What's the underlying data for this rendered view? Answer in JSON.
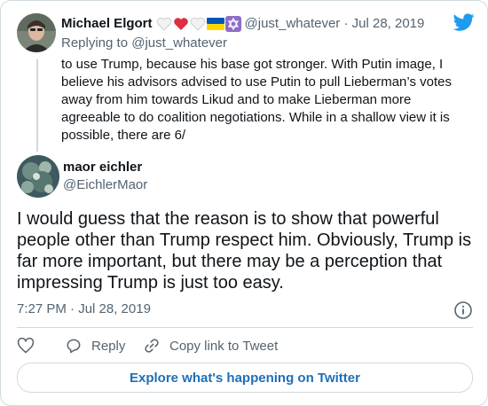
{
  "colors": {
    "twitter_blue": "#1d9bf0",
    "text_primary": "#0f1419",
    "text_secondary": "#536471",
    "border": "#cfd9de",
    "link": "#1d6fb8"
  },
  "icons": {
    "logo": "twitter-bird-icon",
    "info": "info-icon",
    "like": "heart-icon",
    "reply": "reply-bubble-icon",
    "copy_link": "link-icon"
  },
  "parent_tweet": {
    "author_name": "Michael Elgort",
    "name_emojis": [
      "white-heart",
      "red-heart",
      "white-heart",
      "ukraine-flag",
      "star-of-david"
    ],
    "handle_time": "@just_whatever · Jul 28, 2019",
    "replying_prefix": "Replying to",
    "replying_handle": "@just_whatever",
    "text": "to use Trump, because his base got stronger. With Putin image, I believe his advisors advised to use Putin to pull Lieberman’s votes away from him towards Likud and to make Lieberman more agreeable to do coalition negotiations. While in a shallow view it is possible, there are 6/"
  },
  "tweet": {
    "author_name": "maor eichler",
    "author_handle": "@EichlerMaor",
    "text": "I would guess that the reason is to show that powerful people other than Trump respect him. Obviously, Trump is far more important, but there may be a perception that impressing Trump is just too easy.",
    "timestamp": "7:27 PM · Jul 28, 2019"
  },
  "actions": {
    "reply_label": "Reply",
    "copy_link_label": "Copy link to Tweet"
  },
  "explore_button_label": "Explore what's happening on Twitter"
}
